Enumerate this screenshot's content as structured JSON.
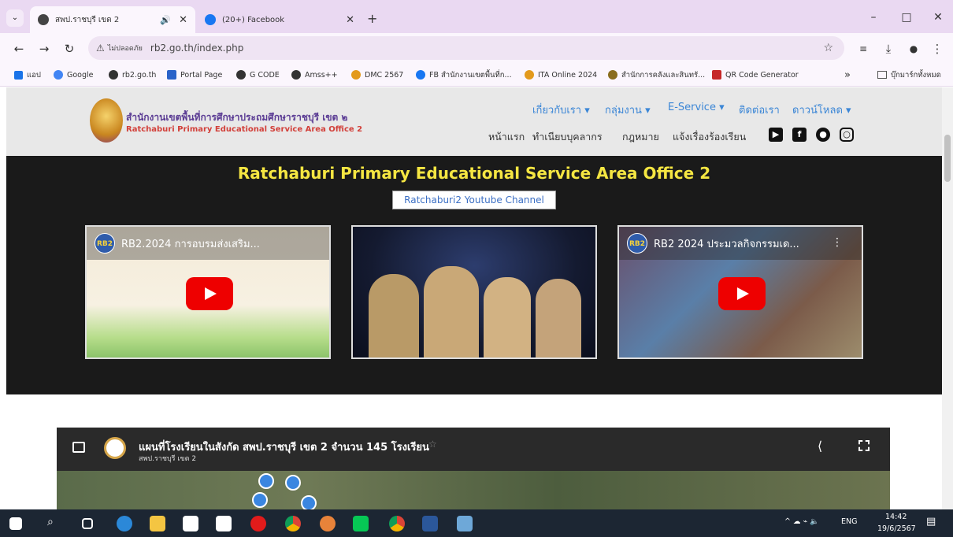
{
  "browser": {
    "tabs": [
      {
        "label": "สพป.ราชบุรี เขต 2",
        "active": true
      },
      {
        "label": "(20+) Facebook",
        "active": false
      }
    ],
    "new_tab": "+",
    "window": {
      "minimize": "–",
      "maximize": "□",
      "close": "✕"
    },
    "nav": {
      "back": "←",
      "forward": "→",
      "reload": "↻"
    },
    "address": {
      "security_chip": "ไม่ปลอดภัย",
      "url": "rb2.go.th/index.php"
    },
    "bookmarks": [
      {
        "label": "แอป",
        "color": "#5f6368"
      },
      {
        "label": "Google",
        "color": "#4285f4"
      },
      {
        "label": "rb2.go.th",
        "color": "#333333"
      },
      {
        "label": "Portal Page",
        "color": "#2a62c9"
      },
      {
        "label": "G CODE",
        "color": "#333333"
      },
      {
        "label": "Amss++",
        "color": "#333333"
      },
      {
        "label": "DMC 2567",
        "color": "#e39a1c"
      },
      {
        "label": "FB สำนักงานเขตพื้นที่ก...",
        "color": "#1877f2"
      },
      {
        "label": "ITA Online 2024",
        "color": "#e39a1c"
      },
      {
        "label": "สำนักการคลังและสินทรั...",
        "color": "#8a6d1e"
      },
      {
        "label": "QR Code Generator",
        "color": "#c62828"
      }
    ],
    "bookmarks_more": "»",
    "bookmarks_folder": "บุ๊กมาร์กทั้งหมด"
  },
  "site": {
    "org_th": "สำนักงานเขตพื้นที่การศึกษาประถมศึกษาราชบุรี เขต ๒",
    "org_en": "Ratchaburi Primary Educational Service Area Office 2",
    "menu_top": [
      "เกี่ยวกับเรา ▾",
      "กลุ่มงาน ▾",
      "E-Service ▾",
      "ติดต่อเรา",
      "ดาวน์โหลด ▾"
    ],
    "menu_bottom": [
      "หน้าแรก",
      "ทำเนียบบุคลากร",
      "กฎหมาย",
      "แจ้งเรื่องร้องเรียน"
    ],
    "social": [
      "youtube-icon",
      "facebook-icon",
      "messenger-icon",
      "instagram-icon"
    ]
  },
  "video_section": {
    "title": "Ratchaburi Primary Educational Service Area Office 2",
    "channel_link": "Ratchaburi2 Youtube Channel",
    "videos": [
      {
        "title": "RB2.2024 การอบรมส่งเสริม...",
        "badge": "RB2"
      },
      {
        "title": "",
        "badge": ""
      },
      {
        "title": "RB2 2024 ประมวลกิจกรรมเด...",
        "badge": "RB2"
      }
    ]
  },
  "map": {
    "title": "แผนที่โรงเรียนในสังกัด สพป.ราชบุรี เขต 2 จำนวน 145 โรงเรียน",
    "subtitle": "สพป.ราชบุรี เขต 2"
  },
  "taskbar": {
    "language": "ENG",
    "time": "14:42",
    "date": "19/6/2567"
  }
}
